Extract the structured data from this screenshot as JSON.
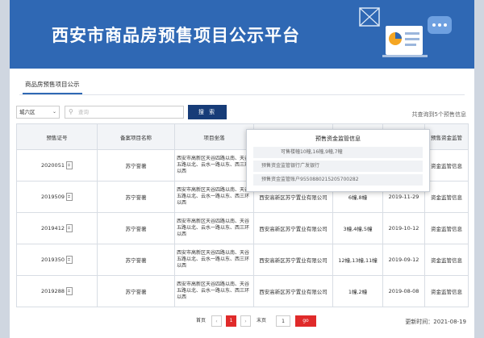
{
  "header": {
    "title": "西安市商品房预售项目公示平台"
  },
  "tabs": [
    {
      "label": "商品房预售项目公示"
    }
  ],
  "search": {
    "district": "城六区",
    "placeholder": "查询",
    "button": "搜 索",
    "result_text": "共查询到5个预售信息"
  },
  "table": {
    "headers": [
      "预售证号",
      "备案项目名称",
      "项目坐落",
      "开发企业",
      "预售楼栋",
      "发证日期",
      "预售资金监管"
    ],
    "rows": [
      {
        "cert": "2020051",
        "name": "苏宁誉著",
        "location": "西安市高新区天谷四路以南、天谷五路以北、云水一路以东、西三环以西",
        "developer": "",
        "buildings": "",
        "date": "",
        "supervision": "资金监管信息"
      },
      {
        "cert": "2019509",
        "name": "苏宁誉著",
        "location": "西安市高新区天谷四路以南、天谷五路以北、云水一路以东、西三环以西",
        "developer": "西安高新区苏宁置业有限公司",
        "buildings": "6幢,8幢",
        "date": "2019-11-29",
        "supervision": "资金监管信息"
      },
      {
        "cert": "2019412",
        "name": "苏宁誉著",
        "location": "西安市高新区天谷四路以南、天谷五路以北、云水一路以东、西三环以西",
        "developer": "西安高新区苏宁置业有限公司",
        "buildings": "3幢,4幢,5幢",
        "date": "2019-10-12",
        "supervision": "资金监管信息"
      },
      {
        "cert": "2019350",
        "name": "苏宁誉著",
        "location": "西安市高新区天谷四路以南、天谷五路以北、云水一路以东、西三环以西",
        "developer": "西安高新区苏宁置业有限公司",
        "buildings": "12幢,13幢,11幢",
        "date": "2019-09-12",
        "supervision": "资金监管信息"
      },
      {
        "cert": "2019288",
        "name": "苏宁誉著",
        "location": "西安市高新区天谷四路以南、天谷五路以北、云水一路以东、西三环以西",
        "developer": "西安高新区苏宁置业有限公司",
        "buildings": "1幢,2幢",
        "date": "2019-08-08",
        "supervision": "资金监管信息"
      }
    ]
  },
  "popup": {
    "title": "预售资金监管信息",
    "rows": [
      {
        "label": "可售楼幢",
        "value": "10幢,16幢,9幢,7幢"
      },
      {
        "label": "预售资金监管银行",
        "value": "广发银行"
      },
      {
        "label": "预售资金监管账户",
        "value": "9550880215205700282"
      }
    ]
  },
  "pager": {
    "first": "首页",
    "prev": "‹",
    "current": "1",
    "next": "›",
    "last": "末页",
    "page_input": "1",
    "go": "go"
  },
  "footer": {
    "update_time": "更新时间：2021-08-19"
  },
  "colors": {
    "header_bg": "#2f68b4",
    "search_btn": "#173c78",
    "accent_red": "#e02a2a",
    "link_orange": "#f0a020",
    "link_blue": "#2f68b4"
  }
}
